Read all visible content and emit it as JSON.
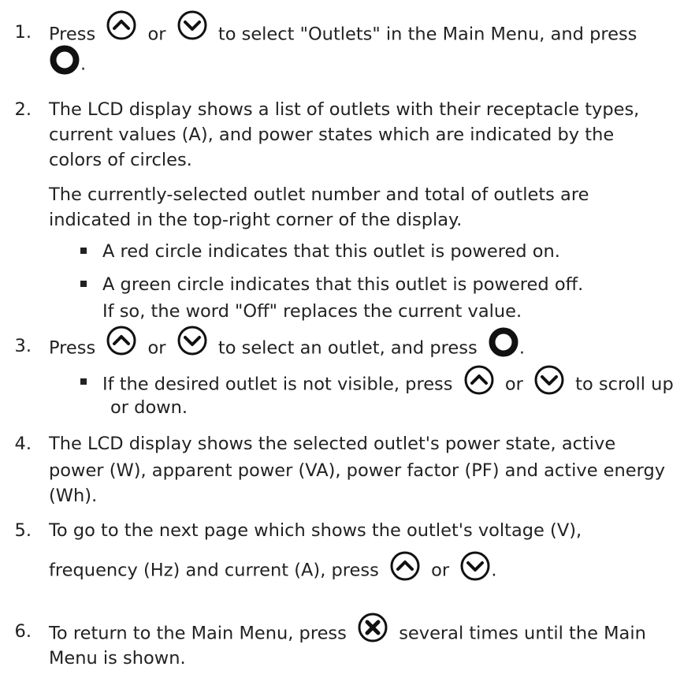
{
  "step1": {
    "num": "1.",
    "a": "Press",
    "or": "or",
    "b": "to select \"Outlets\" in the Main Menu, and press",
    "end": "."
  },
  "step2": {
    "num": "2.",
    "line1": "The LCD display shows a list of outlets with their receptacle types,",
    "line2": "current values (A), and power states which are indicated by the",
    "line3": "colors of circles.",
    "para1": "The currently-selected outlet number and total of outlets are",
    "para2": "indicated in the top-right corner of the display.",
    "bullet1": "A red circle indicates that this outlet is powered on.",
    "bullet2": "A green circle indicates that this outlet is powered off.",
    "bullet2_cont": "If so, the word \"Off\" replaces the current value."
  },
  "step3": {
    "num": "3.",
    "a": "Press",
    "or": "or",
    "b": "to select an outlet, and press",
    "end": ".",
    "sub_a": "If the desired outlet is not visible, press",
    "sub_or": "or",
    "sub_b": "to scroll up",
    "sub_cont": "or down."
  },
  "step4": {
    "num": "4.",
    "line1": "The LCD display shows the selected outlet's power state, active",
    "line2": "power (W), apparent power (VA), power factor (PF) and active energy",
    "line3": "(Wh)."
  },
  "step5": {
    "num": "5.",
    "line1": "To go to the next page which shows the outlet's voltage (V),",
    "line2": "frequency (Hz) and current (A), press",
    "or": "or",
    "end": "."
  },
  "step6": {
    "num": "6.",
    "a": "To return to the Main Menu, press",
    "b": "several times until the Main",
    "line2": "Menu is shown."
  },
  "icons": {
    "up": "chevron-up-circle-icon",
    "down": "chevron-down-circle-icon",
    "ok": "ring-ok-icon",
    "cancel": "x-circle-icon"
  },
  "colors": {
    "text": "#222222",
    "icon": "#111111"
  }
}
